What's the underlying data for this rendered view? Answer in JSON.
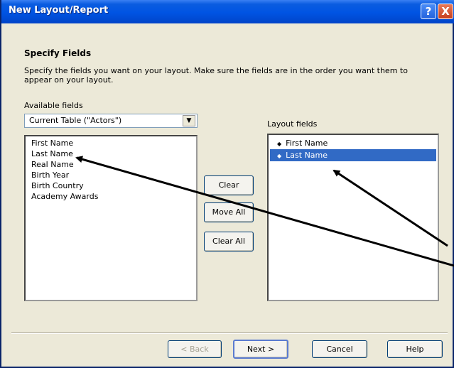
{
  "window": {
    "title": "New Layout/Report",
    "help_glyph": "?",
    "close_glyph": "X"
  },
  "section": {
    "heading": "Specify Fields",
    "description": "Specify the fields you want on your layout. Make sure the fields are in the order you want them to appear on your layout."
  },
  "available": {
    "label": "Available fields",
    "table_select": "Current Table (\"Actors\")",
    "items": [
      "First Name",
      "Last Name",
      "Real Name",
      "Birth Year",
      "Birth Country",
      "Academy Awards"
    ]
  },
  "middle_buttons": {
    "clear": "Clear",
    "move_all": "Move All",
    "clear_all": "Clear All"
  },
  "layout": {
    "label": "Layout fields",
    "items": [
      {
        "label": "First Name",
        "selected": false
      },
      {
        "label": "Last Name",
        "selected": true
      }
    ]
  },
  "footer": {
    "back": "< Back",
    "next": "Next >",
    "cancel": "Cancel",
    "help": "Help"
  },
  "colors": {
    "titlebar": "#0054e3",
    "dialog_bg": "#ece9d8",
    "selection": "#316ac5"
  }
}
